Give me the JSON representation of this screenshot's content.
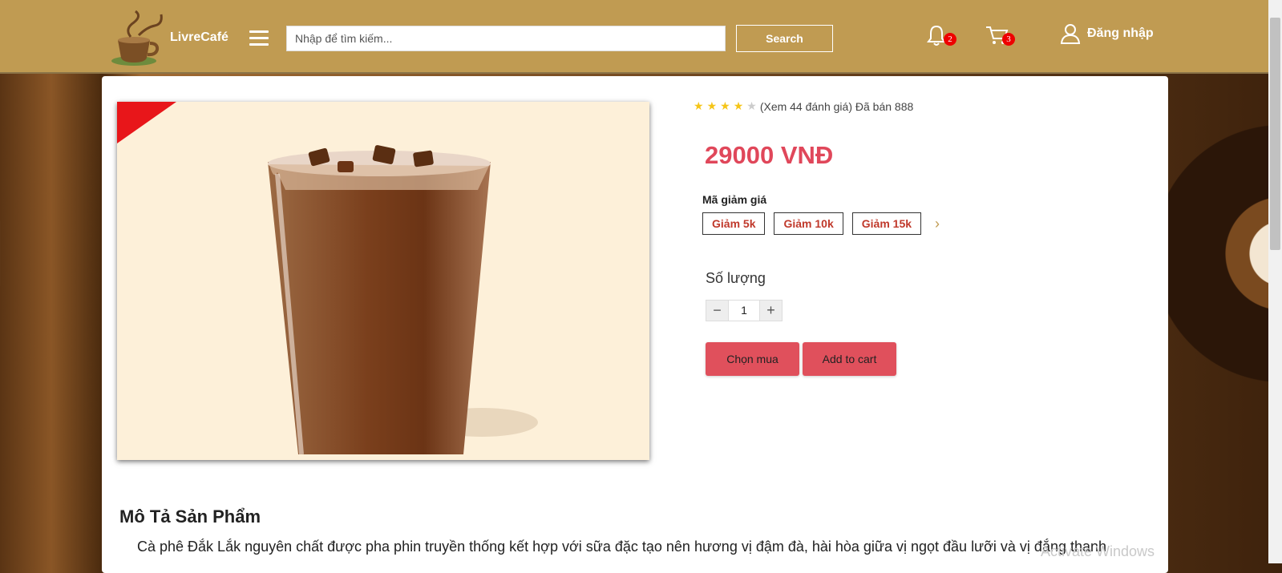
{
  "header": {
    "brand": "LivreCafé",
    "search_placeholder": "Nhập để tìm kiếm...",
    "search_label": "Search",
    "notifications_count": "2",
    "cart_count": "3",
    "login_label": "Đăng nhập"
  },
  "product": {
    "rating_stars": 4,
    "rating_text": "(Xem 44 đánh giá) Đã bán 888",
    "price": "29000 VNĐ",
    "coupon_label": "Mã giảm giá",
    "coupons": [
      "Giảm 5k",
      "Giảm 10k",
      "Giảm 15k"
    ],
    "quantity_label": "Số lượng",
    "quantity": "1",
    "buy_label": "Chọn mua",
    "add_cart_label": "Add to cart"
  },
  "description": {
    "title": "Mô Tả Sản Phẩm",
    "text": "Cà phê Đắk Lắk nguyên chất được pha phin truyền thống kết hợp với sữa đặc tạo nên hương vị đậm đà, hài hòa giữa vị ngọt đầu lưỡi và vị đắng thanh"
  },
  "watermark": "Activate Windows",
  "colors": {
    "header": "#c09b52",
    "accent": "#e0475a",
    "badge": "#e00000"
  }
}
